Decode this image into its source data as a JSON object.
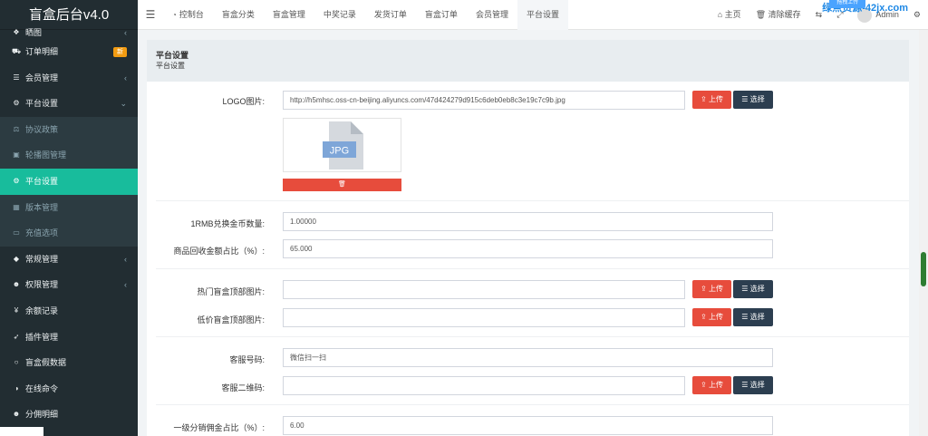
{
  "app": {
    "title": "盲盒后台v4.0"
  },
  "sidebar": {
    "items": [
      {
        "label": "晒图",
        "icon": "gift-icon",
        "has_arrow": true
      },
      {
        "label": "订单明细",
        "icon": "cart-icon",
        "badge": "新"
      },
      {
        "label": "会员管理",
        "icon": "list-icon",
        "has_arrow": true
      },
      {
        "label": "平台设置",
        "icon": "gear-icon",
        "has_arrow": true,
        "expanded": true
      },
      {
        "label": "协议政策",
        "icon": "balance-icon",
        "sub": true
      },
      {
        "label": "轮播图管理",
        "icon": "image-icon",
        "sub": true
      },
      {
        "label": "平台设置",
        "icon": "gear-icon",
        "sub": true,
        "active": true
      },
      {
        "label": "版本管理",
        "icon": "table-icon",
        "sub": true
      },
      {
        "label": "充值选项",
        "icon": "card-icon",
        "sub": true
      },
      {
        "label": "常规管理",
        "icon": "cube-icon",
        "has_arrow": true
      },
      {
        "label": "权限管理",
        "icon": "users-icon",
        "has_arrow": true
      },
      {
        "label": "余额记录",
        "icon": "yen-icon"
      },
      {
        "label": "插件管理",
        "icon": "rocket-icon"
      },
      {
        "label": "盲盒假数据",
        "icon": "circle-icon"
      },
      {
        "label": "在线命令",
        "icon": "half-circle-icon"
      },
      {
        "label": "分佣明细",
        "icon": "users-icon"
      }
    ]
  },
  "topbar": {
    "tabs": [
      {
        "label": "控制台",
        "icon": "dashboard-icon"
      },
      {
        "label": "盲盒分类"
      },
      {
        "label": "盲盒管理"
      },
      {
        "label": "中奖记录"
      },
      {
        "label": "发货订单"
      },
      {
        "label": "盲盒订单"
      },
      {
        "label": "会员管理"
      },
      {
        "label": "平台设置",
        "active": true
      }
    ],
    "home_label": "主页",
    "clear_cache_label": "清除缓存",
    "user_name": "Admin",
    "watermark": "绿点资源-42jx.com",
    "watermark_badge": "拖拽上传"
  },
  "panel": {
    "title": "平台设置",
    "subtitle": "平台设置"
  },
  "form": {
    "upload_label": "上传",
    "select_label": "选择",
    "logo": {
      "label": "LOGO图片:",
      "value": "http://h5mhsc.oss-cn-beijing.aliyuncs.com/47d424279d915c6deb0eb8c3e19c7c9b.jpg",
      "thumb_text": "JPG"
    },
    "rmb_rate": {
      "label": "1RMB兑换金币数量:",
      "value": "1.00000"
    },
    "recycle_ratio": {
      "label": "商品回收金额占比（%）:",
      "value": "65.000"
    },
    "hot_banner": {
      "label": "热门盲盒顶部图片:",
      "value": ""
    },
    "cheap_banner": {
      "label": "低价盲盒顶部图片:",
      "value": ""
    },
    "service_phone": {
      "label": "客服号码:",
      "value": "微信扫一扫"
    },
    "service_qr": {
      "label": "客服二维码:",
      "value": ""
    },
    "commission": {
      "label": "一级分销佣金占比（%）:",
      "value": "6.00"
    }
  },
  "colors": {
    "sidebar_bg": "#222d32",
    "active_green": "#18bc9c",
    "danger": "#e74c3c",
    "dark": "#2c3e50"
  }
}
